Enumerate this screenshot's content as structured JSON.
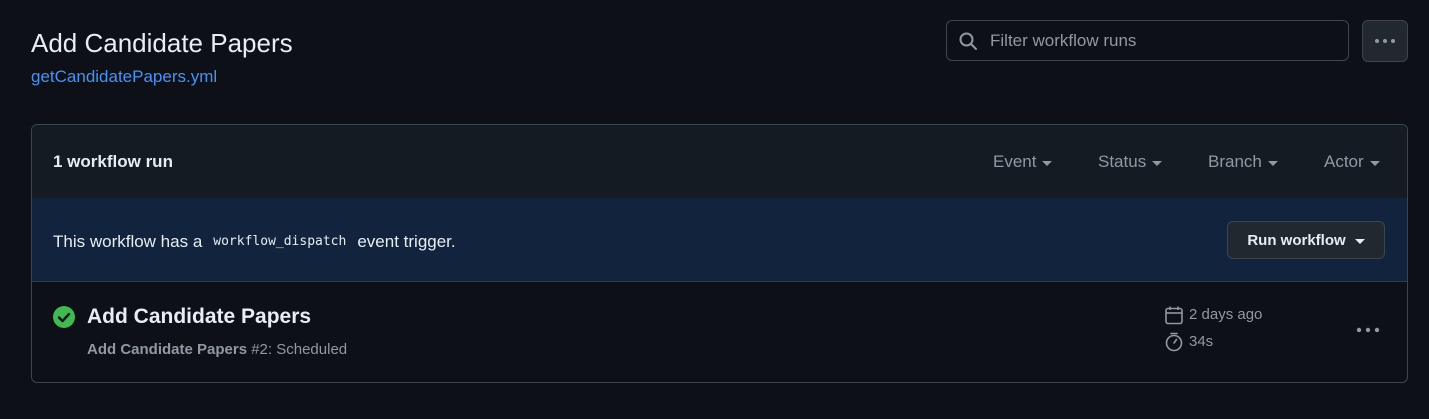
{
  "header": {
    "title": "Add Candidate Papers",
    "workflow_file": "getCandidatePapers.yml"
  },
  "search": {
    "placeholder": "Filter workflow runs",
    "value": ""
  },
  "runs_header": {
    "count_label": "1 workflow run",
    "filters": [
      "Event",
      "Status",
      "Branch",
      "Actor"
    ]
  },
  "banner": {
    "text_before": "This workflow has a",
    "code": "workflow_dispatch",
    "text_after": "event trigger.",
    "button_label": "Run workflow"
  },
  "runs": [
    {
      "title": "Add Candidate Papers",
      "workflow_name": "Add Candidate Papers",
      "run_info": "#2: Scheduled",
      "time_ago": "2 days ago",
      "duration": "34s",
      "status": "success",
      "status_color": "#3fb950"
    }
  ],
  "colors": {
    "background": "#0d1117",
    "link": "#4493f8",
    "banner_bg": "#12233d",
    "muted_text": "#9198a1"
  }
}
